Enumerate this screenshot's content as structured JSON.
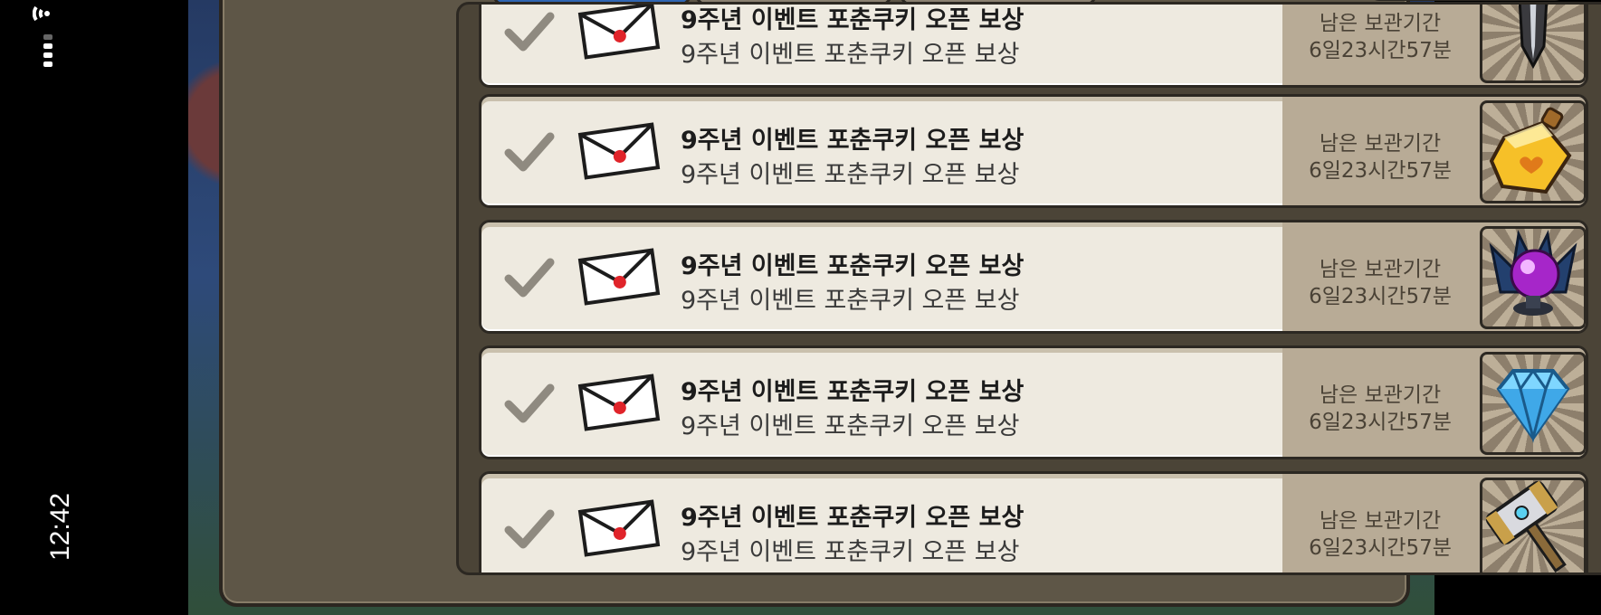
{
  "status_bar": {
    "time": "12:42",
    "icons": [
      "wifi-icon",
      "signal-icon"
    ]
  },
  "mail_list": {
    "items": [
      {
        "title": "9주년 이벤트 포춘쿠키 오픈 보상",
        "description": "9주년 이벤트 포춘쿠키 오픈 보상",
        "expire_label": "남은 보관기간",
        "expire_value": "6일23시간57분",
        "reward_icon": "dagger-icon"
      },
      {
        "title": "9주년 이벤트 포춘쿠키 오픈 보상",
        "description": "9주년 이벤트 포춘쿠키 오픈 보상",
        "expire_label": "남은 보관기간",
        "expire_value": "6일23시간57분",
        "reward_icon": "potion-icon"
      },
      {
        "title": "9주년 이벤트 포춘쿠키 오픈 보상",
        "description": "9주년 이벤트 포춘쿠키 오픈 보상",
        "expire_label": "남은 보관기간",
        "expire_value": "6일23시간57분",
        "reward_icon": "crystal-orb-icon"
      },
      {
        "title": "9주년 이벤트 포춘쿠키 오픈 보상",
        "description": "9주년 이벤트 포춘쿠키 오픈 보상",
        "expire_label": "남은 보관기간",
        "expire_value": "6일23시간57분",
        "reward_icon": "diamond-icon"
      },
      {
        "title": "9주년 이벤트 포춘쿠키 오픈 보상",
        "description": "9주년 이벤트 포춘쿠키 오픈 보상",
        "expire_label": "남은 보관기간",
        "expire_value": "6일23시간57분",
        "reward_icon": "hammer-icon"
      }
    ]
  },
  "colors": {
    "row_bg": "#eeeae0",
    "expire_panel": "#b8ab96",
    "tab_active": "#2f66b3",
    "seal_red": "#e0242a"
  }
}
